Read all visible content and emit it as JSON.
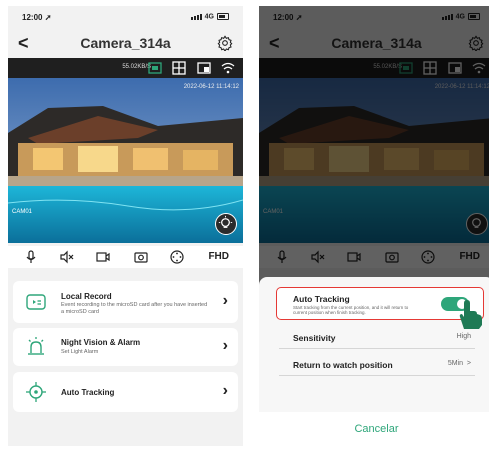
{
  "status": {
    "time": "12:00",
    "network": "4G"
  },
  "header": {
    "back": "<",
    "title": "Camera_314a"
  },
  "video": {
    "speed": "55.02KB/S",
    "timestamp": "2022-06-12 11:14:12",
    "cam_label": "CAM01"
  },
  "toolbar": {
    "quality": "FHD"
  },
  "cards": [
    {
      "title": "Local Record",
      "subtitle": "Event recording to the microSD card after you have inserted a microSD card"
    },
    {
      "title": "Night Vision & Alarm",
      "subtitle": "Set Light Alarm"
    },
    {
      "title": "Auto Tracking"
    }
  ],
  "sheet": {
    "auto_tracking": {
      "label": "Auto Tracking",
      "subtitle": "Start tracking from the current position, and it will return to current position when finish tracking.",
      "enabled": true
    },
    "sensitivity": {
      "label": "Sensitivity",
      "value": "High"
    },
    "return_position": {
      "label": "Return to watch position",
      "value": "5Min",
      "chevron": ">"
    },
    "cancel": "Cancelar"
  },
  "colors": {
    "accent": "#2ea67a",
    "highlight": "#e53935",
    "dark_bar": "#1f1f1f"
  }
}
